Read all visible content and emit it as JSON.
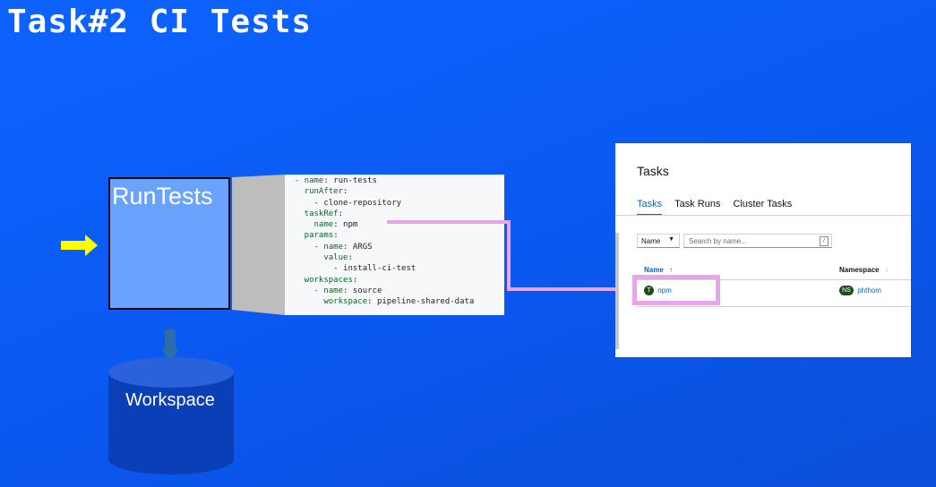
{
  "slide": {
    "title": "Task#2 CI Tests"
  },
  "task": {
    "label": "RunTests"
  },
  "workspace": {
    "label": "Workspace"
  },
  "yaml_lines": [
    "  - name: run-tests",
    "    runAfter:",
    "      - clone-repository",
    "    taskRef:",
    "      name: npm",
    "    params:",
    "      - name: ARGS",
    "        value:",
    "          - install-ci-test",
    "    workspaces:",
    "      - name: source",
    "        workspace: pipeline-shared-data"
  ],
  "console": {
    "title": "Tasks",
    "tabs": [
      "Tasks",
      "Task Runs",
      "Cluster Tasks"
    ],
    "filter": {
      "label": "Name"
    },
    "search": {
      "placeholder": "Search by name..."
    },
    "columns": {
      "name": "Name",
      "namespace": "Namespace"
    },
    "rows": [
      {
        "badge": "T",
        "name": "npm",
        "ns_badge": "NS",
        "namespace": "phthom"
      }
    ]
  },
  "colors": {
    "background": "#0d63ff",
    "task_box": "#6aa3ff",
    "workspace": "#0a3fb8",
    "arrow": "#ffff00",
    "connector": "#e9a5ea",
    "link": "#0066cc"
  },
  "icons": [
    "arrow-right-icon",
    "arrow-down-icon",
    "caret-down-icon",
    "sort-up-icon",
    "sort-icon"
  ]
}
